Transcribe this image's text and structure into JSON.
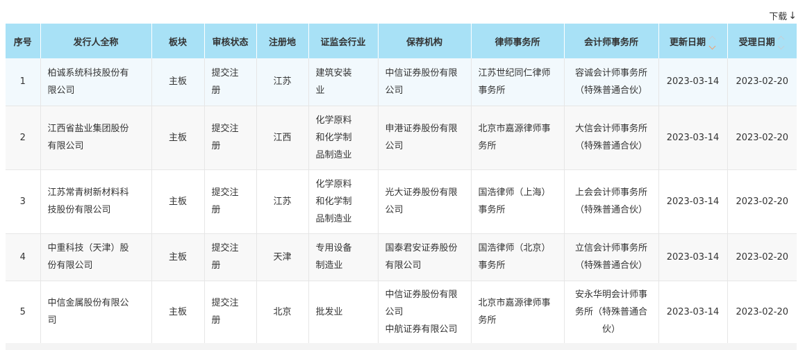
{
  "toolbar": {
    "download_label": "下载",
    "download_icon": "arrow-down-icon"
  },
  "table": {
    "headers": {
      "seq": "序号",
      "issuer": "发行人全称",
      "board": "板块",
      "status": "审核状态",
      "region": "注册地",
      "industry": "证监会行业",
      "sponsor": "保荐机构",
      "law_firm": "律师事务所",
      "accounting_firm": "会计师事务所",
      "updated": "更新日期",
      "accepted": "受理日期"
    },
    "rows": [
      {
        "seq": "1",
        "issuer": [
          "柏诚系统科技股份有",
          "限公司"
        ],
        "board": "主板",
        "status": [
          "提交注",
          "册"
        ],
        "region": "江苏",
        "industry": [
          "建筑安装",
          "业"
        ],
        "sponsor": [
          "中信证券股份有限",
          "公司"
        ],
        "law_firm": [
          "江苏世纪同仁律师",
          "事务所"
        ],
        "accounting_firm": [
          "容诚会计师事务所",
          "（特殊普通合伙）"
        ],
        "updated": "2023-03-14",
        "accepted": "2023-02-20"
      },
      {
        "seq": "2",
        "issuer": [
          "江西省盐业集团股份",
          "有限公司"
        ],
        "board": "主板",
        "status": [
          "提交注",
          "册"
        ],
        "region": "江西",
        "industry": [
          "化学原料",
          "和化学制",
          "品制造业"
        ],
        "sponsor": [
          "申港证券股份有限",
          "公司"
        ],
        "law_firm": [
          "北京市嘉源律师事",
          "务所"
        ],
        "accounting_firm": [
          "大信会计师事务所",
          "（特殊普通合伙）"
        ],
        "updated": "2023-03-14",
        "accepted": "2023-02-20"
      },
      {
        "seq": "3",
        "issuer": [
          "江苏常青树新材料科",
          "技股份有限公司"
        ],
        "board": "主板",
        "status": [
          "提交注",
          "册"
        ],
        "region": "江苏",
        "industry": [
          "化学原料",
          "和化学制",
          "品制造业"
        ],
        "sponsor": [
          "光大证券股份有限",
          "公司"
        ],
        "law_firm": [
          "国浩律师（上海）",
          "事务所"
        ],
        "accounting_firm": [
          "上会会计师事务所",
          "（特殊普通合伙）"
        ],
        "updated": "2023-03-14",
        "accepted": "2023-02-20"
      },
      {
        "seq": "4",
        "issuer": [
          "中重科技（天津）股",
          "份有限公司"
        ],
        "board": "主板",
        "status": [
          "提交注",
          "册"
        ],
        "region": "天津",
        "industry": [
          "专用设备",
          "制造业"
        ],
        "sponsor": [
          "国泰君安证券股份",
          "有限公司"
        ],
        "law_firm": [
          "国浩律师（北京）",
          "事务所"
        ],
        "accounting_firm": [
          "立信会计师事务所",
          "（特殊普通合伙）"
        ],
        "updated": "2023-03-14",
        "accepted": "2023-02-20"
      },
      {
        "seq": "5",
        "issuer": [
          "中信金属股份有限公",
          "司"
        ],
        "board": "主板",
        "status": [
          "提交注",
          "册"
        ],
        "region": "北京",
        "industry": [
          "批发业"
        ],
        "sponsor": [
          "中信证券股份有限",
          "公司",
          "中航证券有限公司"
        ],
        "law_firm": [
          "北京市嘉源律师事",
          "务所"
        ],
        "accounting_firm": [
          "安永华明会计师事",
          "务所（特殊普通合",
          "伙）"
        ],
        "updated": "2023-03-14",
        "accepted": "2023-02-20"
      }
    ]
  }
}
